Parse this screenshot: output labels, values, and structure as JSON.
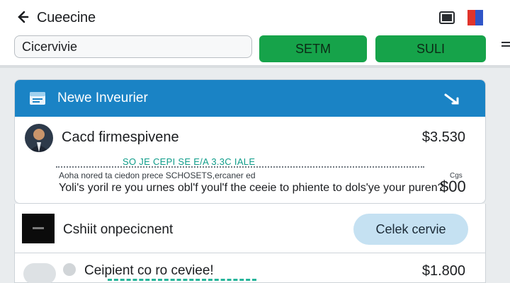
{
  "header": {
    "title": "Cueecine",
    "back_icon": "back-arrow-icon",
    "window_icon": "window-icon",
    "flag_icon": "flag-icon"
  },
  "search": {
    "value": "Cicervivie"
  },
  "toolbar": {
    "setm_label": "SETM",
    "suli_label": "SULI"
  },
  "card": {
    "header_title": "Newe Inveurier",
    "header_icon": "calendar-icon",
    "collapse_icon": "chevron-icon",
    "item": {
      "title": "Cacd firmespivene",
      "price": "$3.530",
      "teal_note": "SO JE CEPI SE E/A 3.3C IALE",
      "small_text": "Aoha nored ta ciedon prece SCHOSETS,ercaner ed",
      "description": "Yoli's yoril re you urnes obl'f youl'f the ceeie to phiente to dols'ye your puren?",
      "small_price_label": "Cgs",
      "small_price": "$00"
    }
  },
  "row2": {
    "title": "Cshiit onpecicnent",
    "button_label": "Celek cervie"
  },
  "row3": {
    "title": "Ceipient co ro ceviee!",
    "price": "$1.800"
  },
  "colors": {
    "accent_blue": "#1a83c5",
    "green_button": "#16a34a",
    "pill_blue": "#c5e1f2",
    "teal": "#0f9d8a"
  }
}
